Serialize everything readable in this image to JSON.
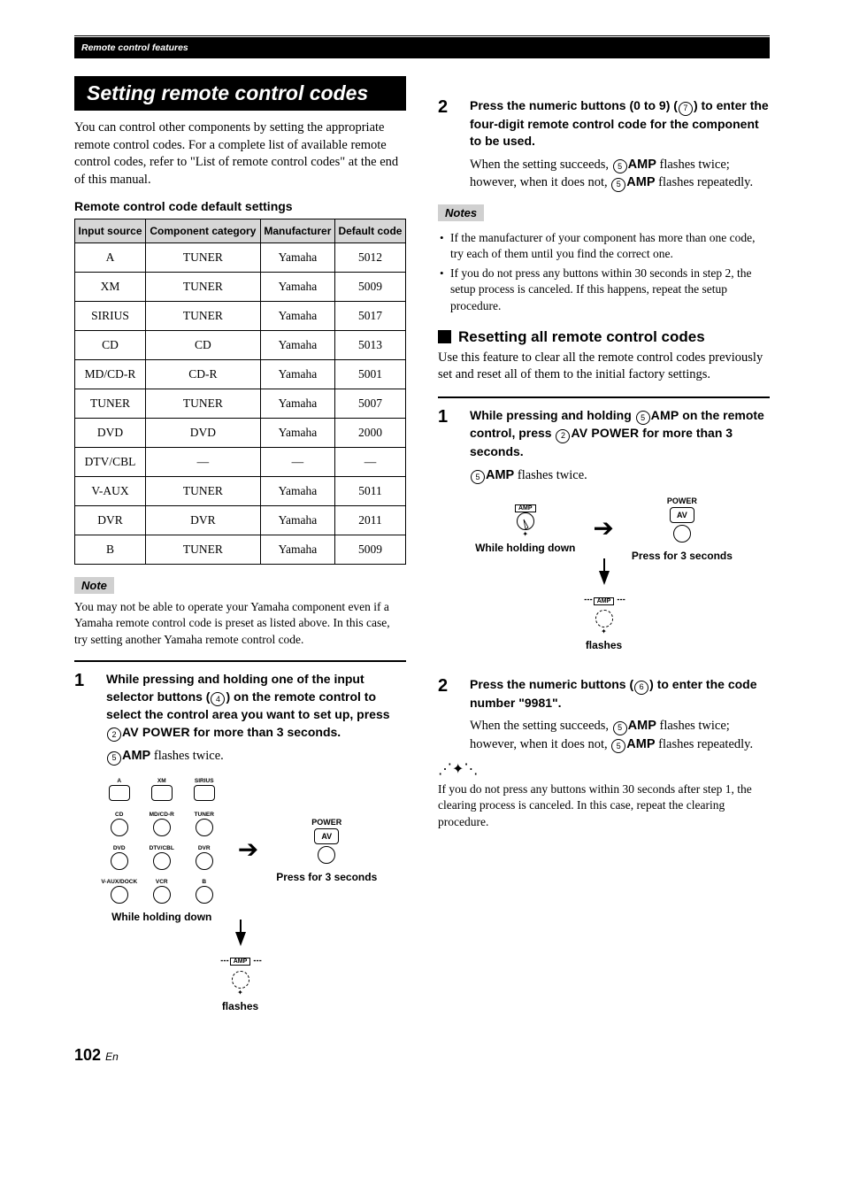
{
  "header": {
    "breadcrumb": "Remote control features"
  },
  "section": {
    "title": "Setting remote control codes"
  },
  "intro": "You can control other components by setting the appropriate remote control codes. For a complete list of available remote control codes, refer to \"List of remote control codes\" at the end of this manual.",
  "table_title": "Remote control code default settings",
  "table": {
    "headers": [
      "Input source",
      "Component category",
      "Manufacturer",
      "Default code"
    ],
    "rows": [
      [
        "A",
        "TUNER",
        "Yamaha",
        "5012"
      ],
      [
        "XM",
        "TUNER",
        "Yamaha",
        "5009"
      ],
      [
        "SIRIUS",
        "TUNER",
        "Yamaha",
        "5017"
      ],
      [
        "CD",
        "CD",
        "Yamaha",
        "5013"
      ],
      [
        "MD/CD-R",
        "CD-R",
        "Yamaha",
        "5001"
      ],
      [
        "TUNER",
        "TUNER",
        "Yamaha",
        "5007"
      ],
      [
        "DVD",
        "DVD",
        "Yamaha",
        "2000"
      ],
      [
        "DTV/CBL",
        "—",
        "—",
        "—"
      ],
      [
        "V-AUX",
        "TUNER",
        "Yamaha",
        "5011"
      ],
      [
        "DVR",
        "DVR",
        "Yamaha",
        "2011"
      ],
      [
        "B",
        "TUNER",
        "Yamaha",
        "5009"
      ]
    ]
  },
  "note_label": "Note",
  "notes_label": "Notes",
  "note1_text": "You may not be able to operate your Yamaha component even if a Yamaha remote control code is preset as listed above. In this case, try setting another Yamaha remote control code.",
  "left_steps": {
    "s1": {
      "pre": "While pressing and holding one of the input selector buttons (",
      "ref4": "4",
      "mid1": ") on the remote control to select the control area you want to set up, press ",
      "ref2": "2",
      "avpower": "AV POWER",
      "post": " for more than 3 seconds.",
      "after_ref5": "5",
      "after_amp": "AMP",
      "after_text": " flashes twice."
    },
    "fig": {
      "buttons": [
        "A",
        "XM",
        "SIRIUS",
        "CD",
        "MD/CD-R",
        "TUNER",
        "DVD",
        "DTV/CBL",
        "DVR",
        "V-AUX/DOCK",
        "VCR",
        "B"
      ],
      "power": "POWER",
      "av": "AV",
      "cap_left": "While holding down",
      "cap_right": "Press for 3 seconds",
      "amp": "AMP",
      "flashes": "flashes"
    }
  },
  "right_steps": {
    "s2": {
      "pre": "Press the numeric buttons (0 to 9) (",
      "ref7": "7",
      "post": ") to enter the four-digit remote control code for the component to be used.",
      "after_pre": "When the setting succeeds, ",
      "ref5a": "5",
      "amp_a": "AMP",
      "after_mid": " flashes twice; however, when it does not, ",
      "ref5b": "5",
      "amp_b": "AMP",
      "after_post": " flashes repeatedly."
    },
    "notes": [
      "If the manufacturer of your component has more than one code, try each of them until you find the correct one.",
      "If you do not press any buttons within 30 seconds in step 2, the setup process is canceled. If this happens, repeat the setup procedure."
    ],
    "reset": {
      "heading": "Resetting all remote control codes",
      "text": "Use this feature to clear all the remote control codes previously set and reset all of them to the initial factory settings.",
      "s1": {
        "pre": "While pressing and holding ",
        "ref5": "5",
        "amp": "AMP",
        "mid": " on the remote control, press ",
        "ref2": "2",
        "avpower": "AV POWER",
        "post": " for more than 3 seconds.",
        "after_ref5": "5",
        "after_amp": "AMP",
        "after_text": " flashes twice."
      },
      "fig": {
        "amp": "AMP",
        "cap_left": "While holding down",
        "power": "POWER",
        "av": "AV",
        "cap_right": "Press for 3 seconds",
        "flashes": "flashes"
      },
      "s2": {
        "pre": "Press the numeric buttons (",
        "ref6": "6",
        "post": ") to enter the code number \"9981\".",
        "after_pre": "When the setting succeeds, ",
        "ref5a": "5",
        "amp_a": "AMP",
        "after_mid": " flashes twice; however, when it does not, ",
        "ref5b": "5",
        "amp_b": "AMP",
        "after_post": " flashes repeatedly."
      },
      "tip": "If you do not press any buttons within 30 seconds after step 1, the clearing process is canceled. In this case, repeat the clearing procedure."
    }
  },
  "page_num": "102",
  "page_suffix": "En"
}
